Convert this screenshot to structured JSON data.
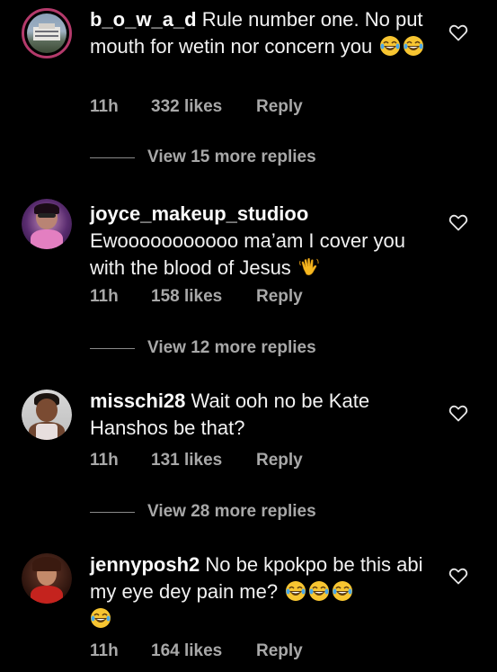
{
  "comments": [
    {
      "username": "b_o_w_a_d",
      "text": " Rule number one. No put mouth for wetin nor concern you ",
      "time": "11h",
      "likes": "332 likes",
      "reply_label": "Reply",
      "view_replies": "View 15 more replies",
      "emoji": [
        "face-with-tears-of-joy",
        "face-with-tears-of-joy"
      ]
    },
    {
      "username": "joyce_makeup_studioo",
      "text": "Ewooooooooooo ma’am I cover you with the blood of Jesus ",
      "time": "11h",
      "likes": "158 likes",
      "reply_label": "Reply",
      "view_replies": "View 12 more replies",
      "emoji": [
        "waving-hand"
      ]
    },
    {
      "username": "misschi28",
      "text": " Wait ooh no be Kate Hanshos be that?",
      "time": "11h",
      "likes": "131 likes",
      "reply_label": "Reply",
      "view_replies": "View 28 more replies",
      "emoji": []
    },
    {
      "username": "jennyposh2",
      "text": " No be kpokpo be this abi my eye dey pain me? ",
      "time": "11h",
      "likes": "164 likes",
      "reply_label": "Reply",
      "emoji": [
        "face-with-tears-of-joy",
        "face-with-tears-of-joy",
        "face-with-tears-of-joy",
        "face-with-tears-of-joy"
      ]
    }
  ],
  "icons": {
    "like": "heart-outline-icon"
  },
  "colors": {
    "background": "#000000",
    "text": "#f5f5f5",
    "meta": "#a8a8a8",
    "story_ring": "#b43a6b"
  }
}
